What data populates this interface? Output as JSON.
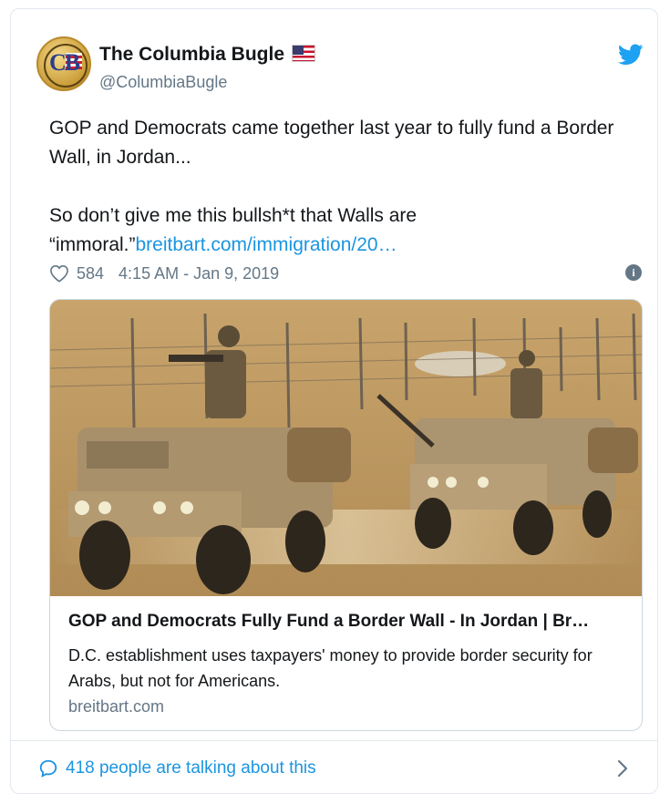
{
  "tweet": {
    "author_name": "The Columbia Bugle",
    "author_handle": "@ColumbiaBugle",
    "avatar_letters": "CB",
    "text_paragraph1": "GOP and Democrats came together last year to fully fund a Border Wall, in Jordan...",
    "text_paragraph2_prefix": "So don’t give me this bullsh*t that Walls are “immoral.”",
    "text_link": "breitbart.com/immigration/20…",
    "likes": "584",
    "timestamp": "4:15 AM - Jan 9, 2019",
    "info_glyph": "i"
  },
  "link_card": {
    "title": "GOP and Democrats Fully Fund a Border Wall - In Jordan | Br…",
    "description": "D.C. establishment uses taxpayers' money to provide border security for Arabs, but not for Americans.",
    "domain": "breitbart.com"
  },
  "footer": {
    "talking_label": "418 people are talking about this"
  },
  "icons": {
    "verified_flag": "us-flag-icon",
    "brand": "twitter-bird-icon",
    "like": "heart-icon",
    "info": "info-icon",
    "reply": "speech-bubble-icon",
    "chevron": "chevron-right-icon"
  },
  "colors": {
    "link_blue": "#1b95e0",
    "muted_gray": "#657786",
    "border": "#e1e8ed"
  }
}
